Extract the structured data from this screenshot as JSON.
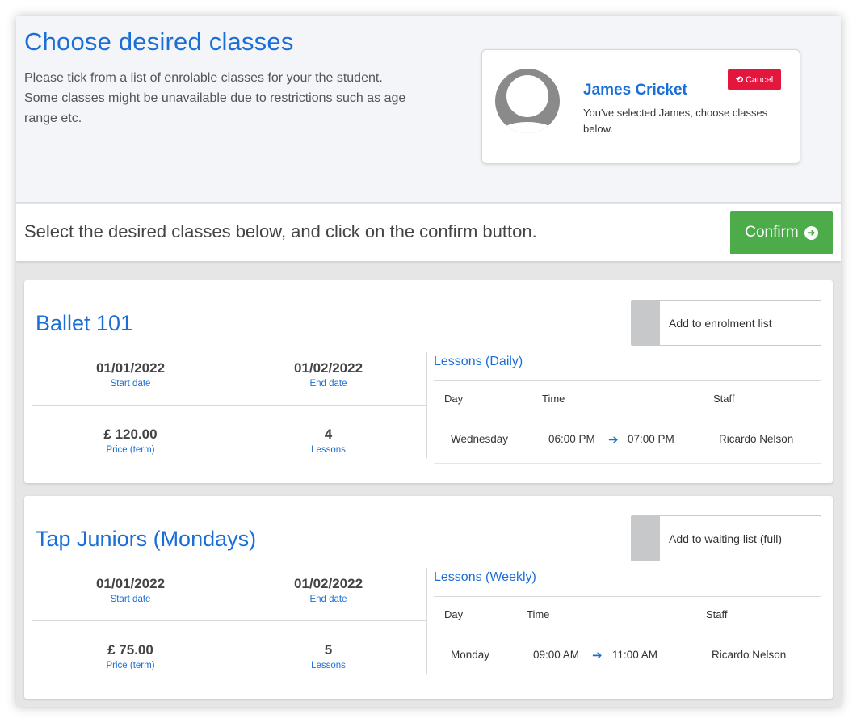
{
  "header": {
    "title": "Choose desired classes",
    "description": "Please tick from a list of enrolable classes for your the student. Some classes might be unavailable due to restrictions such as age range etc."
  },
  "student": {
    "name": "James Cricket",
    "message": "You've selected James, choose classes below.",
    "cancel_label": "Cancel",
    "avatar_icon": "user-avatar-icon"
  },
  "action_bar": {
    "instruction": "Select the desired classes below, and click on the confirm button.",
    "confirm_label": "Confirm",
    "confirm_icon": "arrow-circle-right-icon"
  },
  "colors": {
    "primary": "#1a6fd6",
    "cancel": "#e3173e",
    "confirm": "#4cac4a"
  },
  "classes": [
    {
      "title": "Ballet 101",
      "action_label": "Add to enrolment list",
      "start_date": "01/01/2022",
      "start_date_label": "Start date",
      "end_date": "01/02/2022",
      "end_date_label": "End date",
      "price": "£ 120.00",
      "price_label": "Price (term)",
      "lessons_count": "4",
      "lessons_label": "Lessons",
      "lessons_title": "Lessons (Daily)",
      "columns": [
        "Day",
        "Time",
        "Staff"
      ],
      "rows": [
        {
          "day": "Wednesday",
          "start": "06:00 PM",
          "end": "07:00 PM",
          "staff": "Ricardo Nelson"
        }
      ]
    },
    {
      "title": "Tap Juniors (Mondays)",
      "action_label": "Add to waiting list (full)",
      "start_date": "01/01/2022",
      "start_date_label": "Start date",
      "end_date": "01/02/2022",
      "end_date_label": "End date",
      "price": "£ 75.00",
      "price_label": "Price (term)",
      "lessons_count": "5",
      "lessons_label": "Lessons",
      "lessons_title": "Lessons (Weekly)",
      "columns": [
        "Day",
        "Time",
        "Staff"
      ],
      "rows": [
        {
          "day": "Monday",
          "start": "09:00 AM",
          "end": "11:00 AM",
          "staff": "Ricardo Nelson"
        }
      ]
    }
  ]
}
